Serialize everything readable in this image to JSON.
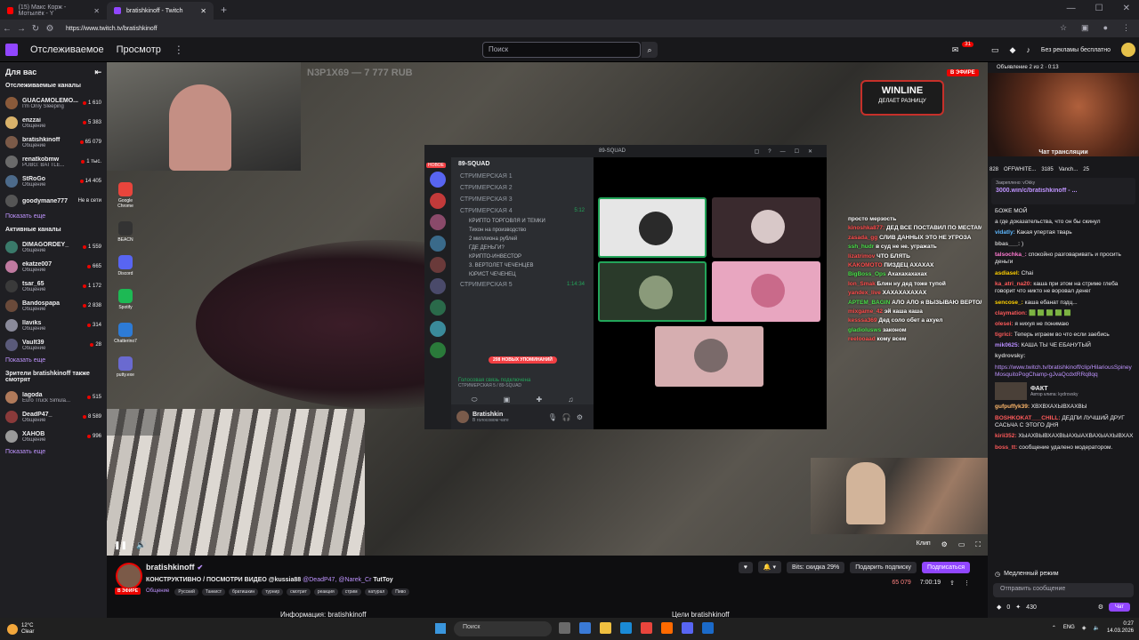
{
  "browser": {
    "tabs": [
      {
        "label": "(15) Макс Корж - Мотылёк - Y",
        "active": false
      },
      {
        "label": "bratishkinoff - Twitch",
        "active": true
      }
    ],
    "url": "https://www.twitch.tv/bratishkinoff"
  },
  "topnav": {
    "following": "Отслеживаемое",
    "browse": "Просмотр",
    "search_placeholder": "Поиск",
    "notif_count": "31",
    "no_ads": "Без рекламы бесплатно"
  },
  "sidebar": {
    "for_you": "Для вас",
    "followed_title": "Отслеживаемые каналы",
    "followed": [
      {
        "name": "GUACAMOLEMO...",
        "cat": "I'm Only Sleeping",
        "viewers": "1 610",
        "color": "#8a5a3a"
      },
      {
        "name": "enzzai",
        "cat": "Общение",
        "viewers": "5 383",
        "color": "#d9b26a"
      },
      {
        "name": "bratishkinoff",
        "cat": "Общение",
        "viewers": "65 079",
        "color": "#7b5a48"
      },
      {
        "name": "renatkobmw",
        "cat": "PUBG: BATTLE...",
        "viewers": "1 тыс.",
        "color": "#6a6a6a"
      },
      {
        "name": "StRoGo",
        "cat": "Общение",
        "viewers": "14 405",
        "color": "#4c6a8a"
      },
      {
        "name": "goodymane777",
        "cat": "",
        "viewers": "Не в сети",
        "color": "#555555"
      }
    ],
    "show_more_1": "Показать еще",
    "live_title": "Активные каналы",
    "live": [
      {
        "name": "DIMAGORDEY_",
        "cat": "Общение",
        "viewers": "1 559",
        "color": "#3a7a6a"
      },
      {
        "name": "ekatze007",
        "cat": "Общение",
        "viewers": "665",
        "color": "#c07aa0"
      },
      {
        "name": "tsar_65",
        "cat": "Общение",
        "viewers": "1 172",
        "color": "#3a3a3a"
      },
      {
        "name": "Bandospapa",
        "cat": "Общение",
        "viewers": "2 838",
        "color": "#6a4a3a"
      },
      {
        "name": "Ilaviks",
        "cat": "Общение",
        "viewers": "314",
        "color": "#8a8a9a"
      },
      {
        "name": "Vault39",
        "cat": "Общение",
        "viewers": "28",
        "color": "#5a5a7a"
      }
    ],
    "show_more_2": "Показать еще",
    "viewers_title": "Зрители bratishkinoff также смотрят",
    "viewers_also": [
      {
        "name": "lagoda",
        "cat": "Euro Truck Simula...",
        "viewers": "515",
        "color": "#b07a5a"
      },
      {
        "name": "DeadP47_",
        "cat": "Общение",
        "viewers": "8 589",
        "color": "#8a3a3a"
      },
      {
        "name": "XAHOB",
        "cat": "Общение",
        "viewers": "996",
        "color": "#9a9a9a"
      }
    ],
    "show_more_3": "Показать еще"
  },
  "stream": {
    "game_title": "N3P1X69 — 7 777 RUB",
    "winline": "WINLINE",
    "winline_sub": "ДЕЛАЕТ РАЗНИЦУ",
    "live_label": "В ЭФИРЕ",
    "desktop_icons": [
      {
        "label": "Google Chrome",
        "color": "#e8453c"
      },
      {
        "label": "BEACN",
        "color": "#333333"
      },
      {
        "label": "Discord",
        "color": "#5865f2"
      },
      {
        "label": "Spotify",
        "color": "#1db954"
      },
      {
        "label": "Chatterino7",
        "color": "#2d7bd6"
      },
      {
        "label": "putty.exe",
        "color": "#6a6ad0"
      }
    ],
    "discord": {
      "window_title": "89-SQUAD",
      "new_label": "НОВОЕ",
      "server_name": "89-SQUAD",
      "channels": [
        {
          "name": "СТРИМЕРСКАЯ 1",
          "time": "",
          "sub": false
        },
        {
          "name": "СТРИМЕРСКАЯ 2",
          "time": "",
          "sub": false
        },
        {
          "name": "СТРИМЕРСКАЯ 3",
          "time": "",
          "sub": false
        },
        {
          "name": "СТРИМЕРСКАЯ 4",
          "time": "5:12",
          "sub": false
        },
        {
          "name": "КРИПТО ТОРГОВЛЯ И ТЕМКИ",
          "time": "",
          "sub": true
        },
        {
          "name": "Тихон на производство",
          "time": "",
          "sub": true
        },
        {
          "name": "2 миллиона рублей",
          "time": "",
          "sub": true
        },
        {
          "name": "ГДЕ ДЕНЬГИ?",
          "time": "",
          "sub": true
        },
        {
          "name": "КРИПТО-ИНВЕСТОР",
          "time": "",
          "sub": true
        },
        {
          "name": "3. ВЕРТОЛЕТ ЧЕЧЕНЦЕВ",
          "time": "",
          "sub": true
        },
        {
          "name": "ЮРИСТ ЧЕЧЕНЕЦ",
          "time": "",
          "sub": true
        },
        {
          "name": "СТРИМЕРСКАЯ 5",
          "time": "1:14:34",
          "sub": false
        }
      ],
      "mentions": "208 НОВЫХ УПОМИНАНИЙ",
      "voice_status": "Голосовая связь подключена",
      "voice_channel": "СТРИМЕРСКАЯ 5 / 89-SQUAD",
      "user_name": "Bratishkin",
      "user_status": "В голосовом чате"
    },
    "overlay_chat": [
      {
        "user": "",
        "text": "просто мерзость"
      },
      {
        "user": "kinoshka877:",
        "text": "ДЕД ВСЕ ПОСТАВИЛ ПО МЕСТАМ"
      },
      {
        "user": "zasada_gg",
        "text": "СЛИВ ДАННЫХ ЭТО НЕ УГРОЗА"
      },
      {
        "user": "ssh_hudr",
        "text": "в суд не не. угражать"
      },
      {
        "user": "lizatrimov",
        "text": "ЧТО БЛЯТЬ"
      },
      {
        "user": "KAKOMOTO",
        "text": "ПИЗДЕЦ АХАХАХ"
      },
      {
        "user": "BigBoss_Ops",
        "text": "Ахахахахахах"
      },
      {
        "user": "Ion_Smak",
        "text": "Блин ну дед тоже тупой"
      },
      {
        "user": "yandex_live",
        "text": "ХАХАХАХАХАХ"
      },
      {
        "user": "APTEM_BAGIN",
        "text": "АЛО АЛО я ВЫЗЫВАЮ ВЕРТОЛЕТ ЮРИСТОВ ВАХПХАВПХВХП"
      },
      {
        "user": "mixgame_42",
        "text": "эй каша каша"
      },
      {
        "user": "kesssa369",
        "text": "Дед соло обет а ахуел"
      },
      {
        "user": "gladiolusws",
        "text": "законом"
      },
      {
        "user": "reelooaad",
        "text": "кому всем"
      }
    ],
    "clip_label": "Клип"
  },
  "info": {
    "live_label": "В ЭФИРЕ",
    "name": "bratishkinoff",
    "title_a": "КОНСТРУКТИВНО / ПОСМОТРИ ВИДЕО @kussia88",
    "title_m1": "@DeadP47,",
    "title_m2": "@Narek_Cr",
    "title_b": "TutToy",
    "category": "Общение",
    "tags": [
      "Русский",
      "Танкист",
      "братишкин",
      "турнир",
      "смотрит",
      "реакция",
      "стрим",
      "натурал",
      "Пиво"
    ],
    "bits": "Bits: скидка 29%",
    "gift": "Подарить подписку",
    "subscribe": "Подписаться",
    "viewers": "65 079",
    "uptime": "7:00:19",
    "about": "Информация: bratishkinoff",
    "goals": "Цели bratishkinoff"
  },
  "chat": {
    "ad_label": "Объявление 2 из 2 · 0:13",
    "title": "Чат трансляции",
    "gifts": [
      "828",
      "OFFWHITE...",
      "3185",
      "Vanch...",
      "25"
    ],
    "pinned_label": "Закреплено: vOkky",
    "pinned_text": "3000.win/c/bratishkinoff - ...",
    "messages": [
      {
        "user": "",
        "text": "БОЖЕ МОЙ",
        "color": "#efeff1"
      },
      {
        "user": "",
        "text": "а где доказательства, что он бы скинул",
        "color": "#efeff1"
      },
      {
        "user": "vidatly:",
        "text": "Какая упертая тварь",
        "color": "#5db8ff"
      },
      {
        "user": "bbas___:",
        "text": ")",
        "color": "#c7c7c7"
      },
      {
        "user": "talsochka_:",
        "text": "спокойно разговаривать и просить деньги",
        "color": "#ff7ad1"
      },
      {
        "user": "asdiasel:",
        "text": "Chai",
        "color": "#ffd000"
      },
      {
        "user": "ka_atri_na20:",
        "text": "каша при этом на стриме глеба говорит что никто не воровал денег",
        "color": "#ff5a5a"
      },
      {
        "user": "sencose_:",
        "text": "каша ебанат пздц...",
        "color": "#ffd000"
      },
      {
        "user": "claymation:",
        "text": "🟩 🟩 🟩 🟩 🟩",
        "color": "#ff5a5a"
      },
      {
        "user": "olesei:",
        "text": "я нихуя не понимаю",
        "color": "#ff5a5a"
      },
      {
        "user": "tigrici:",
        "text": "Теперь играем во что если заебись",
        "color": "#ff5a5a"
      },
      {
        "user": "mik0625:",
        "text": "КАША ТЫ ЧЕ ЕБАНУТЫЙ",
        "color": "#b78cff"
      },
      {
        "user": "kydrovsky:",
        "text": "",
        "color": "#c7c7c7"
      }
    ],
    "clip_link": "https://www.twitch.tv/bratishkinoff/clip/HilariousSpineyMosquitoPogChamp-gJvaQcdxtRRq8qq",
    "clip_title": "ФАКТ",
    "clip_author": "Автор клипа: kydrovsky",
    "messages2": [
      {
        "user": "gufpuffyk39:",
        "text": "ХВХВХАХЫВХАХВЫ",
        "color": "#ffb86b"
      },
      {
        "user": "BOSHKOKAT___CHILL:",
        "text": "ДЕДПИ ЛУЧШИЙ ДРУГ САСЬЧА С ЭТОГО ДНЯ",
        "color": "#ff5a5a"
      },
      {
        "user": "kirii352:",
        "text": "ХЫАХВЫВХАХВЫАХЫАХВАХЫАХЫВХАХ",
        "color": "#ff5a5a"
      },
      {
        "user": "boss_tt:",
        "text": "сообщение удалено модератором.",
        "color": "#ff5a5a"
      }
    ],
    "slow_mode": "Медленный режим",
    "input_placeholder": "Отправить сообщение",
    "points": "430",
    "bits_count": "0",
    "chat_button": "Чат"
  },
  "taskbar": {
    "temp": "12°C",
    "weather": "Clear",
    "search": "Поиск",
    "lang": "ENG",
    "time": "0:27",
    "date": "14.03.2026"
  }
}
